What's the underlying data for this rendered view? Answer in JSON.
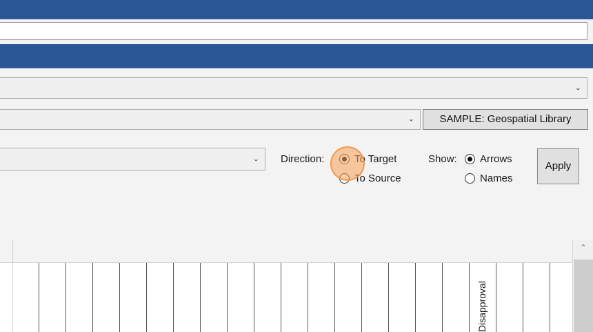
{
  "controls": {
    "library_button": "SAMPLE: Geospatial Library",
    "direction_label": "Direction:",
    "direction_options": [
      "To Target",
      "To Source"
    ],
    "direction_selected": "To Target",
    "show_label": "Show:",
    "show_options": [
      "Arrows",
      "Names"
    ],
    "show_selected": "Arrows",
    "apply_label": "Apply"
  },
  "grid": {
    "visible_column_header": "Disapproval"
  },
  "icons": {
    "dropdown": "chevron-down-icon",
    "scroll_up": "chevron-up-icon"
  },
  "colors": {
    "title_bar": "#2b5797",
    "cursor_highlight": "#f7a256"
  }
}
